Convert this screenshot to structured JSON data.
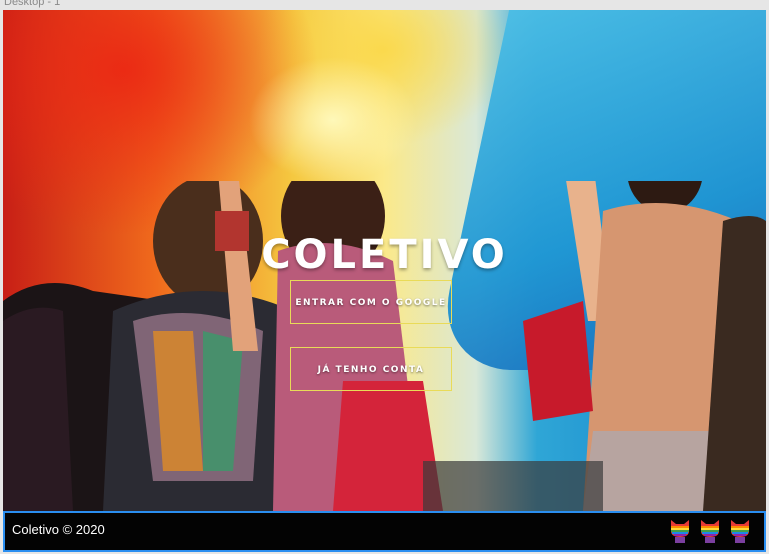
{
  "window": {
    "frame_label": "Desktop - 1"
  },
  "hero": {
    "title": "COLETIVO"
  },
  "actions": {
    "google_button": "ENTRAR COM O GOOGLE",
    "login_button": "JÁ TENHO CONTA"
  },
  "footer": {
    "copyright": "Coletivo © 2020",
    "icons": [
      "rainbow-cat-icon",
      "rainbow-cat-icon",
      "rainbow-cat-icon"
    ]
  },
  "colors": {
    "button_border": "#e9db58",
    "footer_bg": "#030303",
    "footer_border": "#2a8ef0",
    "title": "#ffffff"
  }
}
